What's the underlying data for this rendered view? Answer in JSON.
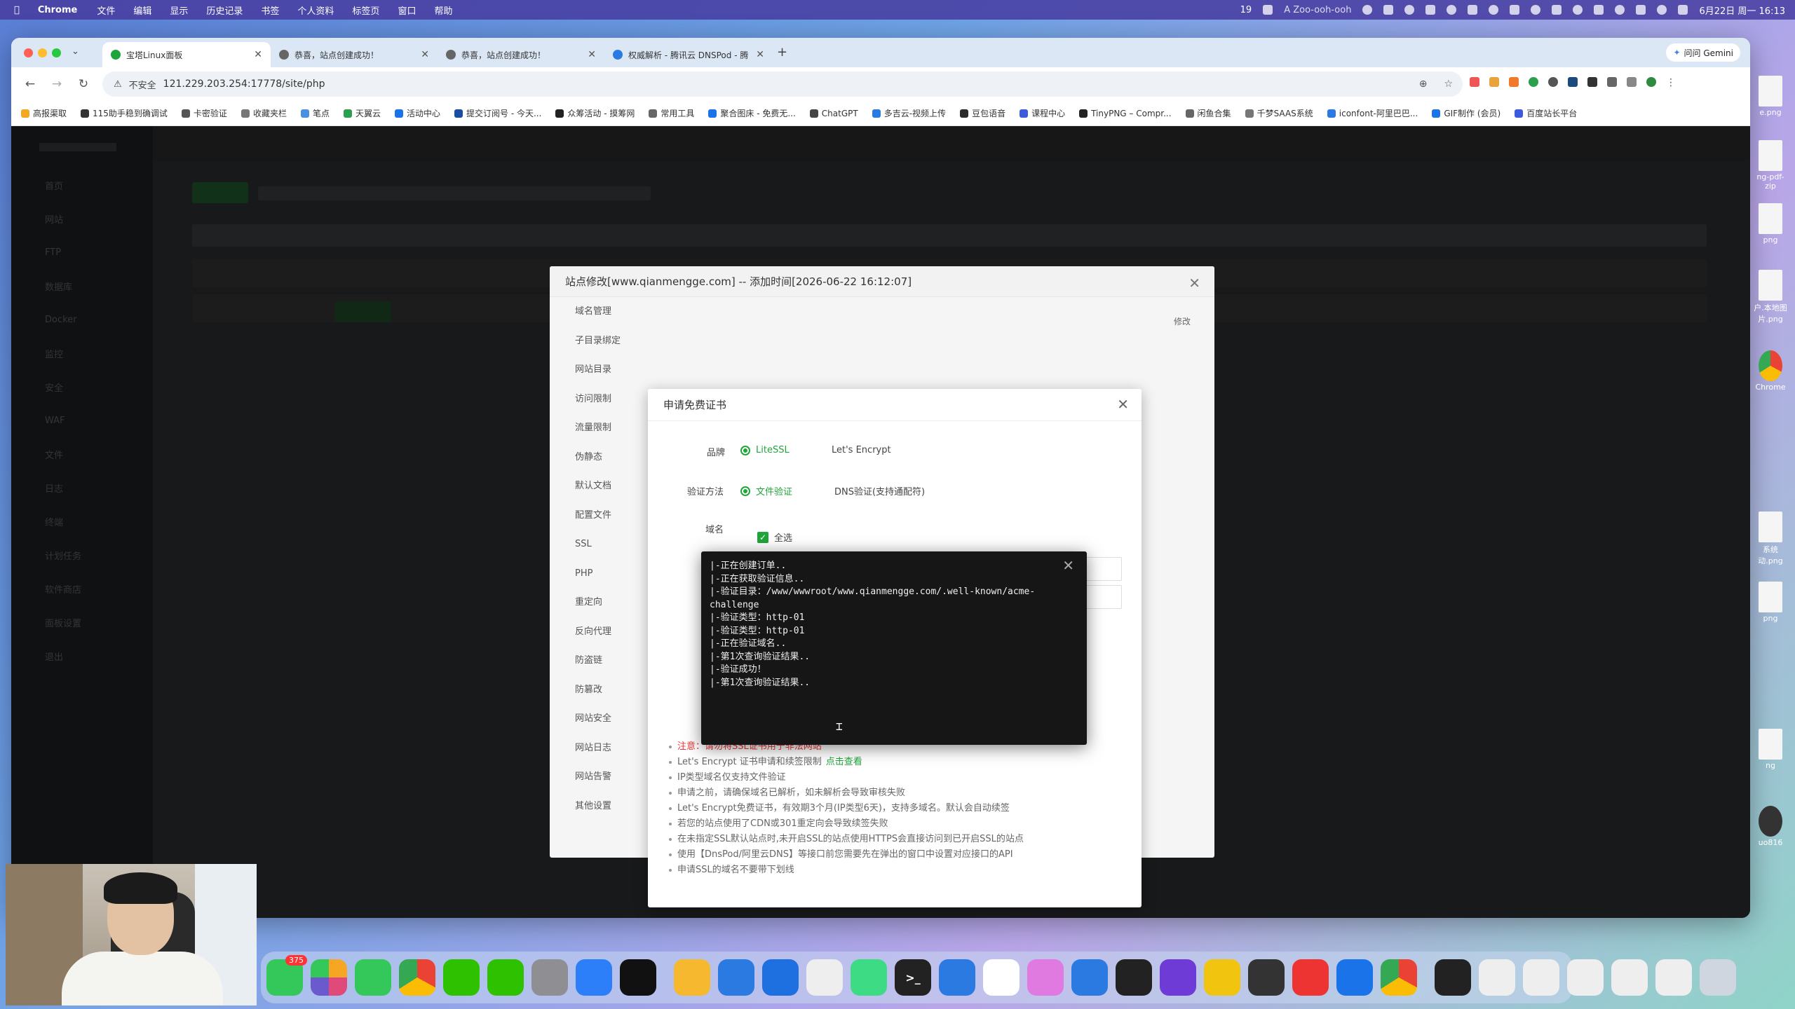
{
  "menubar": {
    "app": "Chrome",
    "items": [
      "文件",
      "编辑",
      "显示",
      "历史记录",
      "书签",
      "个人资料",
      "标签页",
      "窗口",
      "帮助"
    ],
    "status_number": "19",
    "status_user": "A Zoo-ooh-ooh",
    "clock": "6月22日 周一 16:13"
  },
  "browser": {
    "tabs": [
      {
        "title": "宝塔Linux面板",
        "active": true
      },
      {
        "title": "恭喜，站点创建成功！",
        "active": false
      },
      {
        "title": "恭喜，站点创建成功！",
        "active": false
      },
      {
        "title": "权威解析 - 腾讯云 DNSPod - 腾",
        "active": false
      }
    ],
    "new_tab": "+",
    "gemini": "问问 Gemini",
    "url_warning": "不安全",
    "url": "121.229.203.254:17778/site/php",
    "bookmarks": [
      "高报渠取",
      "115助手稳到确调试",
      "卡密验证",
      "收藏夹栏",
      "笔点",
      "天翼云",
      "活动中心",
      "提交订阅号 - 今天...",
      "众筹活动 - 摸筹网",
      "常用工具",
      "聚合图床 - 免费无...",
      "ChatGPT",
      "多吉云-视频上传",
      "豆包语音",
      "课程中心",
      "TinyPNG – Compr...",
      "闲鱼合集",
      "千梦SAAS系统",
      "iconfont-阿里巴巴...",
      "GIF制作 (会员)",
      "百度站长平台"
    ]
  },
  "panel": {
    "sidebar": [
      "首页",
      "网站",
      "FTP",
      "数据库",
      "Docker",
      "监控",
      "安全",
      "WAF",
      "文件",
      "日志",
      "终端",
      "计划任务",
      "软件商店",
      "面板设置",
      "退出"
    ],
    "site_modal": {
      "title": "站点修改[www.qianmengge.com] -- 添加时间[2026-06-22 16:12:07]",
      "menu": [
        "域名管理",
        "子目录绑定",
        "网站目录",
        "访问限制",
        "流量限制",
        "伪静态",
        "默认文档",
        "配置文件",
        "SSL",
        "PHP",
        "重定向",
        "反向代理",
        "防盗链",
        "防篡改",
        "网站安全",
        "网站日志",
        "网站告警",
        "其他设置"
      ]
    },
    "ssl_dialog": {
      "title": "申请免费证书",
      "brand_label": "品牌",
      "brand_options": [
        "LiteSSL",
        "Let's Encrypt"
      ],
      "verify_label": "验证方法",
      "verify_options": [
        "文件验证",
        "DNS验证(支持通配符)"
      ],
      "domain_label": "域名",
      "select_all": "全选",
      "notes": [
        "注意：请勿将SSL证书用于非法网站",
        "Let's Encrypt 证书申请和续签限制",
        "IP类型域名仅支持文件验证",
        "申请之前，请确保域名已解析，如未解析会导致审核失败",
        "Let's Encrypt免费证书，有效期3个月(IP类型6天)，支持多域名。默认会自动续签",
        "若您的站点使用了CDN或301重定向会导致续签失败",
        "在未指定SSL默认站点时,未开启SSL的站点使用HTTPS会直接访问到已开启SSL的站点",
        "使用【DnsPod/阿里云DNS】等接口前您需要先在弹出的窗口中设置对应接口的API",
        "申请SSL的域名不要带下划线"
      ],
      "note_link": "点击查看"
    },
    "log_dialog": {
      "lines": [
        "|-正在创建订单..",
        "|-正在获取验证信息..",
        "|-验证目录：/www/wwwroot/www.qianmengge.com/.well-known/acme-challenge",
        "|-验证类型：http-01",
        "|-验证类型：http-01",
        "|-正在验证域名..",
        "|-第1次查询验证结果..",
        "|-验证成功！",
        "|-第1次查询验证结果.."
      ]
    }
  },
  "desktop": {
    "right_files": [
      "e.png",
      "ng-pdf-zip",
      "png",
      "户.本地图片.png",
      "Chrome",
      "系统动.png",
      "png",
      "ng",
      "uo816"
    ]
  },
  "dock": {
    "messages_badge": "375"
  },
  "colors": {
    "accent_green": "#20a53a",
    "danger": "#e33"
  }
}
